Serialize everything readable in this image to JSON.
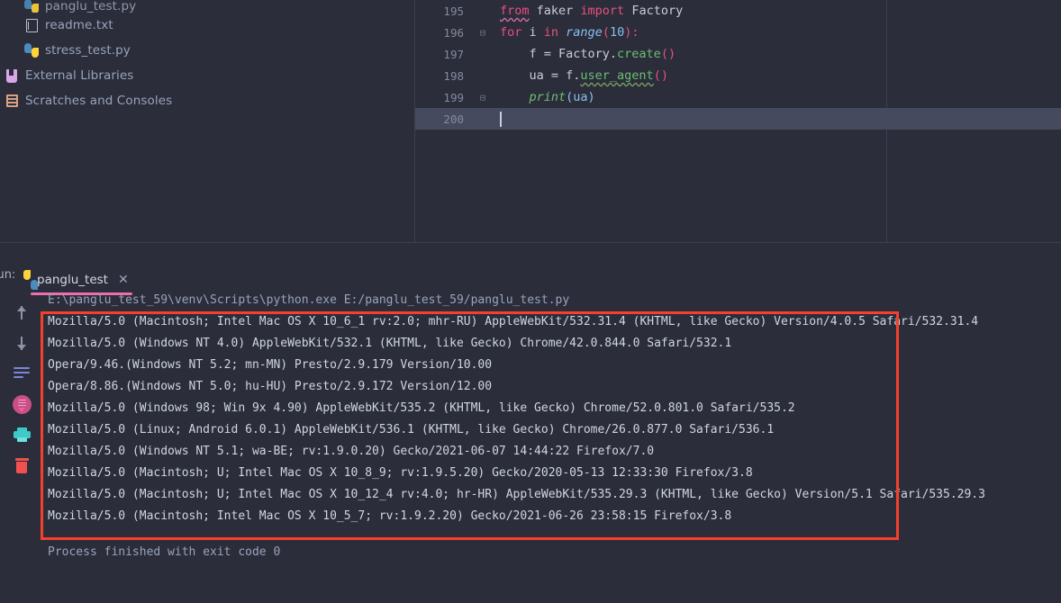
{
  "project_tree": {
    "items": [
      {
        "label": "panglu_test.py",
        "icon": "python-file-icon",
        "indent": 2,
        "cut_off": true
      },
      {
        "label": "readme.txt",
        "icon": "text-file-icon",
        "indent": 2,
        "cut_off": false
      },
      {
        "label": "stress_test.py",
        "icon": "python-file-icon",
        "indent": 2,
        "cut_off": false
      },
      {
        "label": "External Libraries",
        "icon": "library-icon",
        "indent": 1,
        "cut_off": false
      },
      {
        "label": "Scratches and Consoles",
        "icon": "scratches-icon",
        "indent": 1,
        "cut_off": false
      }
    ]
  },
  "editor": {
    "lines": [
      {
        "number": "195",
        "fold": "",
        "current": false
      },
      {
        "number": "196",
        "fold": "minus",
        "current": false
      },
      {
        "number": "197",
        "fold": "",
        "current": false
      },
      {
        "number": "198",
        "fold": "",
        "current": false
      },
      {
        "number": "199",
        "fold": "minus",
        "current": false
      },
      {
        "number": "200",
        "fold": "",
        "current": true
      }
    ],
    "code": {
      "l195_from": "from",
      "l195_module": " faker ",
      "l195_import": "import",
      "l195_factory": " Factory",
      "l196_for": "for",
      "l196_i": " i ",
      "l196_in": "in",
      "l196_range": " range",
      "l196_paren_open": "(",
      "l196_ten": "10",
      "l196_paren_close": "):",
      "l197_f": "    f = Factory.",
      "l197_create": "create",
      "l197_parens": "()",
      "l198_ua": "    ua = f.",
      "l198_user_agent": "user_agent",
      "l198_parens": "()",
      "l199_print": "    print",
      "l199_arg": "(ua)"
    }
  },
  "run_panel": {
    "label": "Run:",
    "tab_name": "panglu_test",
    "tab_icon": "python-file-icon",
    "close_icon": "close-icon",
    "toolbar_icons": [
      "arrow-up-icon",
      "arrow-down-icon",
      "soft-wrap-icon",
      "scroll-to-end-icon",
      "print-icon",
      "trash-icon"
    ],
    "command": "E:\\panglu_test_59\\venv\\Scripts\\python.exe E:/panglu_test_59/panglu_test.py",
    "output_lines": [
      "Mozilla/5.0 (Macintosh; Intel Mac OS X 10_6_1 rv:2.0; mhr-RU) AppleWebKit/532.31.4 (KHTML, like Gecko) Version/4.0.5 Safari/532.31.4",
      "Mozilla/5.0 (Windows NT 4.0) AppleWebKit/532.1 (KHTML, like Gecko) Chrome/42.0.844.0 Safari/532.1",
      "Opera/9.46.(Windows NT 5.2; mn-MN) Presto/2.9.179 Version/10.00",
      "Opera/8.86.(Windows NT 5.0; hu-HU) Presto/2.9.172 Version/12.00",
      "Mozilla/5.0 (Windows 98; Win 9x 4.90) AppleWebKit/535.2 (KHTML, like Gecko) Chrome/52.0.801.0 Safari/535.2",
      "Mozilla/5.0 (Linux; Android 6.0.1) AppleWebKit/536.1 (KHTML, like Gecko) Chrome/26.0.877.0 Safari/536.1",
      "Mozilla/5.0 (Windows NT 5.1; wa-BE; rv:1.9.0.20) Gecko/2021-06-07 14:44:22 Firefox/7.0",
      "Mozilla/5.0 (Macintosh; U; Intel Mac OS X 10_8_9; rv:1.9.5.20) Gecko/2020-05-13 12:33:30 Firefox/3.8",
      "Mozilla/5.0 (Macintosh; U; Intel Mac OS X 10_12_4 rv:4.0; hr-HR) AppleWebKit/535.29.3 (KHTML, like Gecko) Version/5.1 Safari/535.29.3",
      "Mozilla/5.0 (Macintosh; Intel Mac OS X 10_5_7; rv:1.9.2.20) Gecko/2021-06-26 23:58:15 Firefox/3.8"
    ],
    "finished_text": "Process finished with exit code 0",
    "highlight_color": "#f5402c",
    "tab_accent_color": "#ef6eb0"
  }
}
